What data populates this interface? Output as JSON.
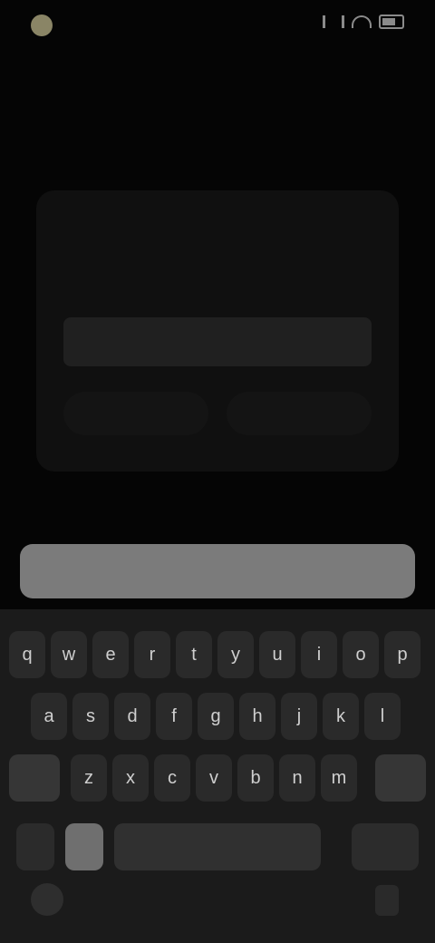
{
  "status": {
    "time": ""
  },
  "screen": {
    "subtitle": "",
    "headline": ""
  },
  "dialog": {
    "title": "",
    "message": "",
    "input_placeholder": "",
    "cancel_label": "",
    "ok_label": ""
  },
  "keyboard": {
    "suggestions": [
      "",
      "",
      ""
    ],
    "row1": [
      "q",
      "w",
      "e",
      "r",
      "t",
      "y",
      "u",
      "i",
      "o",
      "p"
    ],
    "row2": [
      "a",
      "s",
      "d",
      "f",
      "g",
      "h",
      "j",
      "k",
      "l"
    ],
    "row3": [
      "z",
      "x",
      "c",
      "v",
      "b",
      "n",
      "m"
    ]
  },
  "colors": {
    "background": "#050505",
    "dialog": "#101010",
    "keyboard": "#1b1b1b"
  }
}
